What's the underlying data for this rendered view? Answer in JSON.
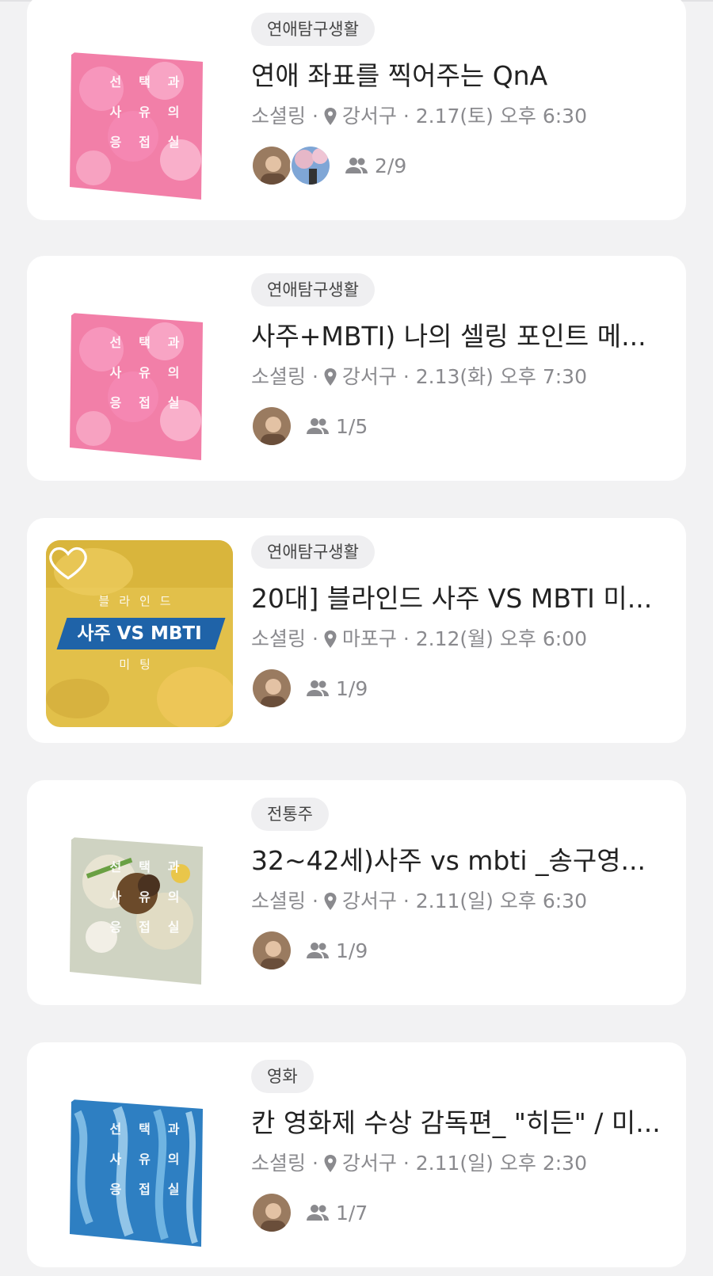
{
  "meetings": [
    {
      "tag": "연애탐구생활",
      "title": "연애 좌표를 찍어주는 QnA",
      "host": "소셜링 ·",
      "location": "강서구",
      "datetime": "· 2.17(토) 오후 6:30",
      "participants": "2/9",
      "thumb_style": "pink",
      "thumb_chars": [
        "선",
        "택",
        "과",
        "사",
        "유",
        "의",
        "응",
        "접",
        "실"
      ]
    },
    {
      "tag": "연애탐구생활",
      "title": "사주+MBTI) 나의 셀링 포인트 메...",
      "host": "소셜링 ·",
      "location": "강서구",
      "datetime": "· 2.13(화) 오후 7:30",
      "participants": "1/5",
      "thumb_style": "pink",
      "thumb_chars": [
        "선",
        "택",
        "과",
        "사",
        "유",
        "의",
        "응",
        "접",
        "실"
      ]
    },
    {
      "tag": "연애탐구생활",
      "title": "20대] 블라인드 사주 VS MBTI 미...",
      "host": "소셜링 ·",
      "location": "마포구",
      "datetime": "· 2.12(월) 오후 6:00",
      "participants": "1/9",
      "thumb_style": "yellow",
      "thumb_top": "블라인드",
      "thumb_main": "사주 VS MBTI",
      "thumb_bottom": "미팅"
    },
    {
      "tag": "전통주",
      "title": "32~42세)사주 vs mbti _송구영...",
      "host": "소셜링 ·",
      "location": "강서구",
      "datetime": "· 2.11(일) 오후 6:30",
      "participants": "1/9",
      "thumb_style": "food",
      "thumb_chars": [
        "선",
        "택",
        "과",
        "사",
        "유",
        "의",
        "응",
        "접",
        "실"
      ]
    },
    {
      "tag": "영화",
      "title": "칸 영화제 수상 감독편_ \"히든\" / 미...",
      "host": "소셜링 ·",
      "location": "강서구",
      "datetime": "· 2.11(일) 오후 2:30",
      "participants": "1/7",
      "thumb_style": "blue",
      "thumb_chars": [
        "선",
        "택",
        "과",
        "사",
        "유",
        "의",
        "응",
        "접",
        "실"
      ]
    }
  ],
  "icons": {
    "favorite": "heart-outline-icon",
    "location": "location-pin-icon",
    "participants": "people-icon"
  },
  "colors": {
    "background": "#f2f2f3",
    "card": "#ffffff",
    "tag_bg": "#efeff1",
    "meta_text": "#8a8a8e"
  }
}
